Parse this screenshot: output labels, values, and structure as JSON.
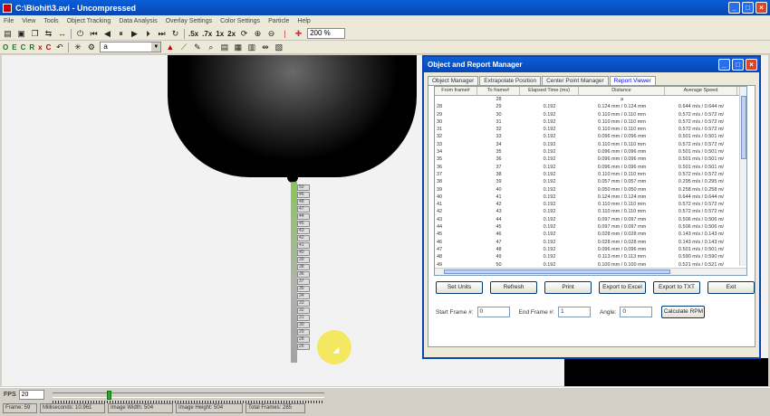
{
  "window": {
    "title": "C:\\Biohit\\3.avi - Uncompressed"
  },
  "menu": [
    "File",
    "View",
    "Tools",
    "Object Tracking",
    "Data Analysis",
    "Overlay Settings",
    "Color Settings",
    "Particle",
    "Help"
  ],
  "toolbar": {
    "zoom_labels": [
      ".5x",
      ".7x",
      "1x",
      "2x"
    ],
    "zoom_value": "200 %",
    "letter_buttons": [
      "O",
      "E",
      "C",
      "R",
      "x",
      "C"
    ],
    "combo_value": "a"
  },
  "tracked_tags": [
    "50",
    "46",
    "48",
    "47",
    "44",
    "45",
    "43",
    "42",
    "41",
    "40",
    "39",
    "38",
    "36",
    "37",
    "35",
    "34",
    "33",
    "32",
    "31",
    "30",
    "29",
    "28",
    "26"
  ],
  "dialog": {
    "title": "Object and Report Manager",
    "tabs": [
      "Object Manager",
      "Extrapolate Position",
      "Center Point Manager",
      "Report Viewer"
    ],
    "active_tab": 3,
    "columns": [
      "From frame#",
      "To frame#",
      "Elapsed Time (ms)",
      "Distance",
      "Average Speed"
    ],
    "first_row": {
      "to": "28",
      "distance": "a"
    },
    "rows": [
      [
        "28",
        "29",
        "0.192",
        "0.124 mm / 0.124 mm",
        "0.644 m/s / 0.644 m/"
      ],
      [
        "29",
        "30",
        "0.192",
        "0.110 mm / 0.110 mm",
        "0.572 m/s / 0.572 m/"
      ],
      [
        "30",
        "31",
        "0.192",
        "0.110 mm / 0.110 mm",
        "0.572 m/s / 0.572 m/"
      ],
      [
        "31",
        "32",
        "0.192",
        "0.110 mm / 0.110 mm",
        "0.572 m/s / 0.572 m/"
      ],
      [
        "32",
        "33",
        "0.192",
        "0.096 mm / 0.096 mm",
        "0.501 m/s / 0.501 m/"
      ],
      [
        "33",
        "34",
        "0.192",
        "0.110 mm / 0.110 mm",
        "0.572 m/s / 0.572 m/"
      ],
      [
        "34",
        "35",
        "0.192",
        "0.096 mm / 0.096 mm",
        "0.501 m/s / 0.501 m/"
      ],
      [
        "35",
        "36",
        "0.192",
        "0.096 mm / 0.096 mm",
        "0.501 m/s / 0.501 m/"
      ],
      [
        "36",
        "37",
        "0.192",
        "0.096 mm / 0.096 mm",
        "0.501 m/s / 0.501 m/"
      ],
      [
        "37",
        "38",
        "0.192",
        "0.110 mm / 0.110 mm",
        "0.572 m/s / 0.572 m/"
      ],
      [
        "38",
        "39",
        "0.192",
        "0.057 mm / 0.057 mm",
        "0.295 m/s / 0.295 m/"
      ],
      [
        "39",
        "40",
        "0.192",
        "0.050 mm / 0.050 mm",
        "0.258 m/s / 0.258 m/"
      ],
      [
        "40",
        "41",
        "0.192",
        "0.124 mm / 0.124 mm",
        "0.644 m/s / 0.644 m/"
      ],
      [
        "41",
        "42",
        "0.192",
        "0.110 mm / 0.110 mm",
        "0.572 m/s / 0.572 m/"
      ],
      [
        "42",
        "43",
        "0.192",
        "0.110 mm / 0.110 mm",
        "0.572 m/s / 0.572 m/"
      ],
      [
        "43",
        "44",
        "0.192",
        "0.097 mm / 0.097 mm",
        "0.506 m/s / 0.506 m/"
      ],
      [
        "44",
        "45",
        "0.192",
        "0.097 mm / 0.097 mm",
        "0.506 m/s / 0.506 m/"
      ],
      [
        "45",
        "46",
        "0.192",
        "0.028 mm / 0.028 mm",
        "0.143 m/s / 0.143 m/"
      ],
      [
        "46",
        "47",
        "0.192",
        "0.028 mm / 0.028 mm",
        "0.143 m/s / 0.143 m/"
      ],
      [
        "47",
        "48",
        "0.192",
        "0.096 mm / 0.096 mm",
        "0.501 m/s / 0.501 m/"
      ],
      [
        "48",
        "49",
        "0.192",
        "0.113 mm / 0.113 mm",
        "0.590 m/s / 0.590 m/"
      ],
      [
        "49",
        "50",
        "0.192",
        "0.100 mm / 0.100 mm",
        "0.521 m/s / 0.521 m/"
      ]
    ],
    "buttons": [
      "Set Units",
      "Refresh",
      "Print",
      "Export to Excel",
      "Export to TXT",
      "Exit"
    ],
    "start_frame_label": "Start Frame #:",
    "start_frame_value": "0",
    "end_frame_label": "End Frame #:",
    "end_frame_value": "1",
    "angle_label": "Angle:",
    "angle_value": "0",
    "calc_button": "Calculate RPM"
  },
  "status": {
    "fps_label": "FPS",
    "fps_value": "20",
    "slider_position": 0.2,
    "frame": "Frame: 59",
    "milliseconds": "Milliseconds: 10.961",
    "image_width": "Image Width: 504",
    "image_height": "Image Height: 504",
    "total_frames": "Total Frames: 285"
  }
}
